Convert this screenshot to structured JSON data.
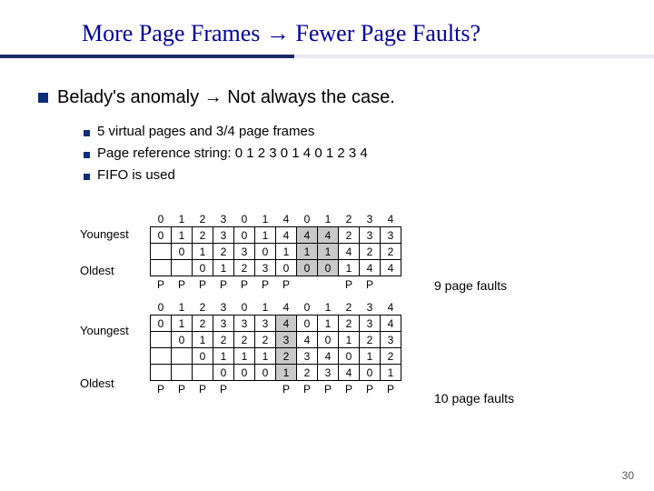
{
  "title": "More Page Frames → Fewer Page Faults?",
  "bullet": "Belady's anomaly →  Not always the case.",
  "sub": [
    "5 virtual pages and 3/4 page frames",
    "Page reference string: 0 1 2 3 0 1 4 0 1 2 3 4",
    "FIFO is used"
  ],
  "labels": {
    "young": "Youngest",
    "old": "Oldest"
  },
  "faults": [
    "9 page faults",
    "10 page faults"
  ],
  "page": "30",
  "chart_data": [
    {
      "type": "table",
      "title": "FIFO with 3 page frames",
      "reference": [
        "0",
        "1",
        "2",
        "3",
        "0",
        "1",
        "4",
        "0",
        "1",
        "2",
        "3",
        "4"
      ],
      "rows": [
        [
          "0",
          "1",
          "2",
          "3",
          "0",
          "1",
          "4",
          "4",
          "4",
          "2",
          "3",
          "3"
        ],
        [
          "",
          "0",
          "1",
          "2",
          "3",
          "0",
          "1",
          "1",
          "1",
          "4",
          "2",
          "2"
        ],
        [
          "",
          "",
          "0",
          "1",
          "2",
          "3",
          "0",
          "0",
          "0",
          "1",
          "4",
          "4"
        ]
      ],
      "faults_row": [
        "P",
        "P",
        "P",
        "P",
        "P",
        "P",
        "P",
        "",
        "",
        "P",
        "P",
        ""
      ],
      "note": "9 page faults"
    },
    {
      "type": "table",
      "title": "FIFO with 4 page frames",
      "reference": [
        "0",
        "1",
        "2",
        "3",
        "0",
        "1",
        "4",
        "0",
        "1",
        "2",
        "3",
        "4"
      ],
      "rows": [
        [
          "0",
          "1",
          "2",
          "3",
          "3",
          "3",
          "4",
          "0",
          "1",
          "2",
          "3",
          "4"
        ],
        [
          "",
          "0",
          "1",
          "2",
          "2",
          "2",
          "3",
          "4",
          "0",
          "1",
          "2",
          "3"
        ],
        [
          "",
          "",
          "0",
          "1",
          "1",
          "1",
          "2",
          "3",
          "4",
          "0",
          "1",
          "2"
        ],
        [
          "",
          "",
          "",
          "0",
          "0",
          "0",
          "1",
          "2",
          "3",
          "4",
          "0",
          "1"
        ]
      ],
      "faults_row": [
        "P",
        "P",
        "P",
        "P",
        "",
        "",
        "P",
        "P",
        "P",
        "P",
        "P",
        "P"
      ],
      "note": "10 page faults"
    }
  ]
}
